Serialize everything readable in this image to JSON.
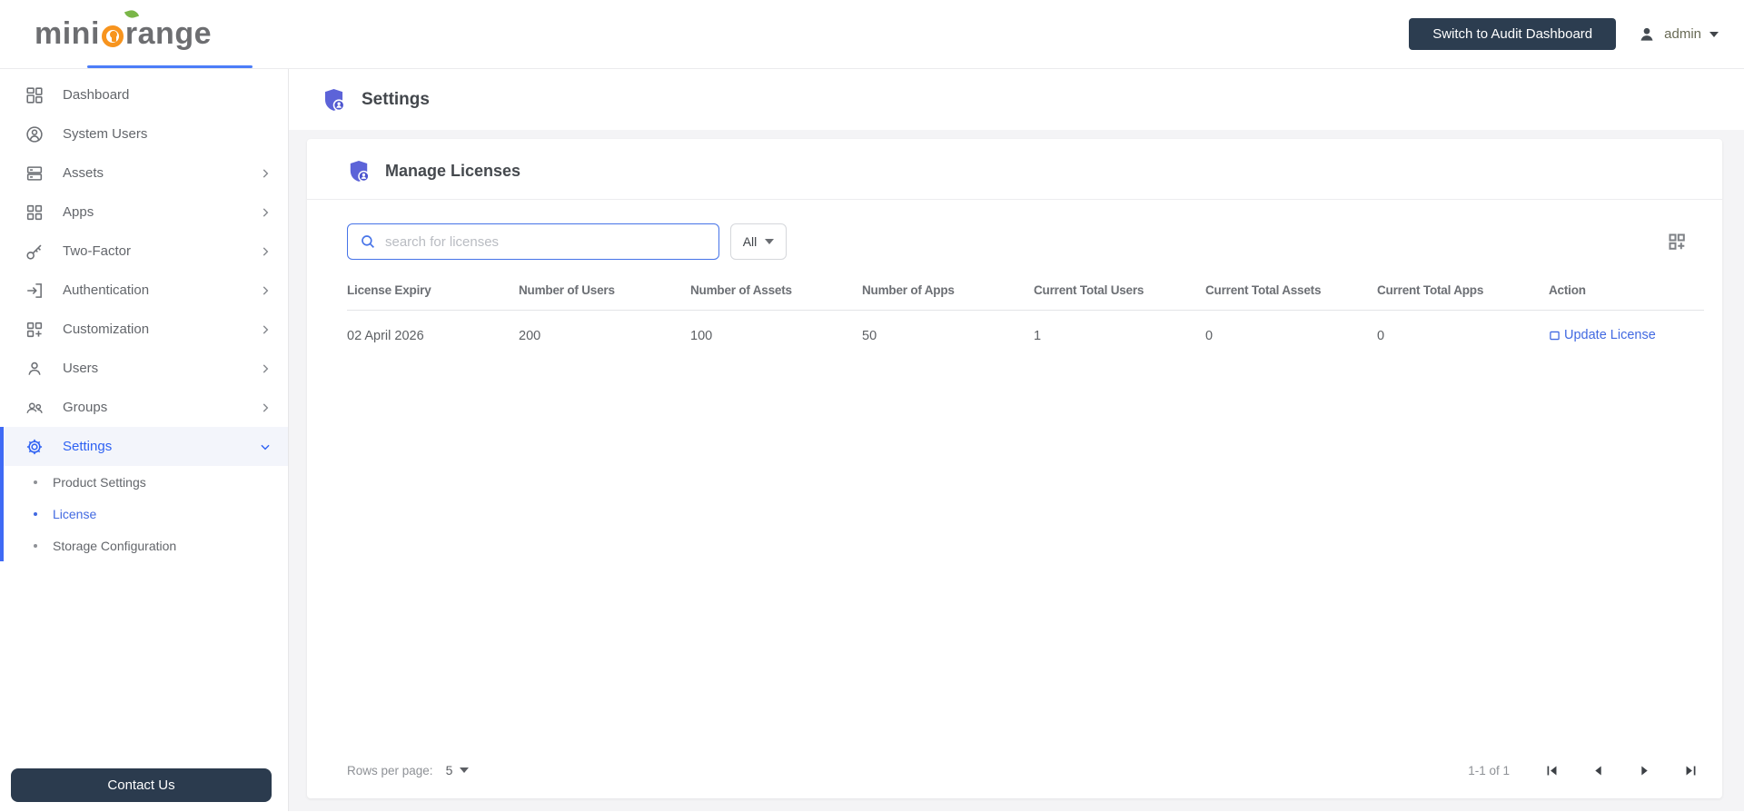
{
  "brand": {
    "logo_text_1": "mini",
    "logo_text_2": "range"
  },
  "topbar": {
    "switch_dashboard_button": "Switch to Audit Dashboard",
    "username": "admin"
  },
  "sidebar": {
    "items": [
      {
        "label": "Dashboard",
        "icon": "dashboard-icon",
        "expandable": false
      },
      {
        "label": "System Users",
        "icon": "system-users-icon",
        "expandable": false
      },
      {
        "label": "Assets",
        "icon": "assets-icon",
        "expandable": true
      },
      {
        "label": "Apps",
        "icon": "apps-icon",
        "expandable": true
      },
      {
        "label": "Two-Factor",
        "icon": "two-factor-icon",
        "expandable": true
      },
      {
        "label": "Authentication",
        "icon": "authentication-icon",
        "expandable": true
      },
      {
        "label": "Customization",
        "icon": "customization-icon",
        "expandable": true
      },
      {
        "label": "Users",
        "icon": "users-icon",
        "expandable": true
      },
      {
        "label": "Groups",
        "icon": "groups-icon",
        "expandable": true
      },
      {
        "label": "Settings",
        "icon": "settings-icon",
        "expandable": true,
        "expanded": true,
        "active": true
      }
    ],
    "settings_submenu": [
      {
        "label": "Product Settings",
        "active": false
      },
      {
        "label": "License",
        "active": true
      },
      {
        "label": "Storage Configuration",
        "active": false
      }
    ],
    "contact_button": "Contact Us"
  },
  "page": {
    "title": "Settings"
  },
  "panel": {
    "title": "Manage Licenses",
    "search": {
      "placeholder": "search for licenses",
      "value": ""
    },
    "filter": {
      "selected": "All"
    },
    "table": {
      "columns": [
        "License Expiry",
        "Number of Users",
        "Number of Assets",
        "Number of Apps",
        "Current Total Users",
        "Current Total Assets",
        "Current Total Apps",
        "Action"
      ],
      "rows": [
        {
          "license_expiry": "02 April 2026",
          "number_of_users": "200",
          "number_of_assets": "100",
          "number_of_apps": "50",
          "current_total_users": "1",
          "current_total_assets": "0",
          "current_total_apps": "0",
          "action_label": "Update License"
        }
      ]
    },
    "pagination": {
      "rows_per_page_label": "Rows per page:",
      "rows_per_page_value": "5",
      "range": "1-1 of 1"
    }
  },
  "colors": {
    "accent_blue": "#3f6af5",
    "link_blue": "#4169e1",
    "navy_button": "#2c3d50",
    "brand_orange": "#f7941e",
    "brand_gray": "#6d6e71",
    "shield_purple": "#5c63d8",
    "leaf_green": "#7ab648"
  }
}
